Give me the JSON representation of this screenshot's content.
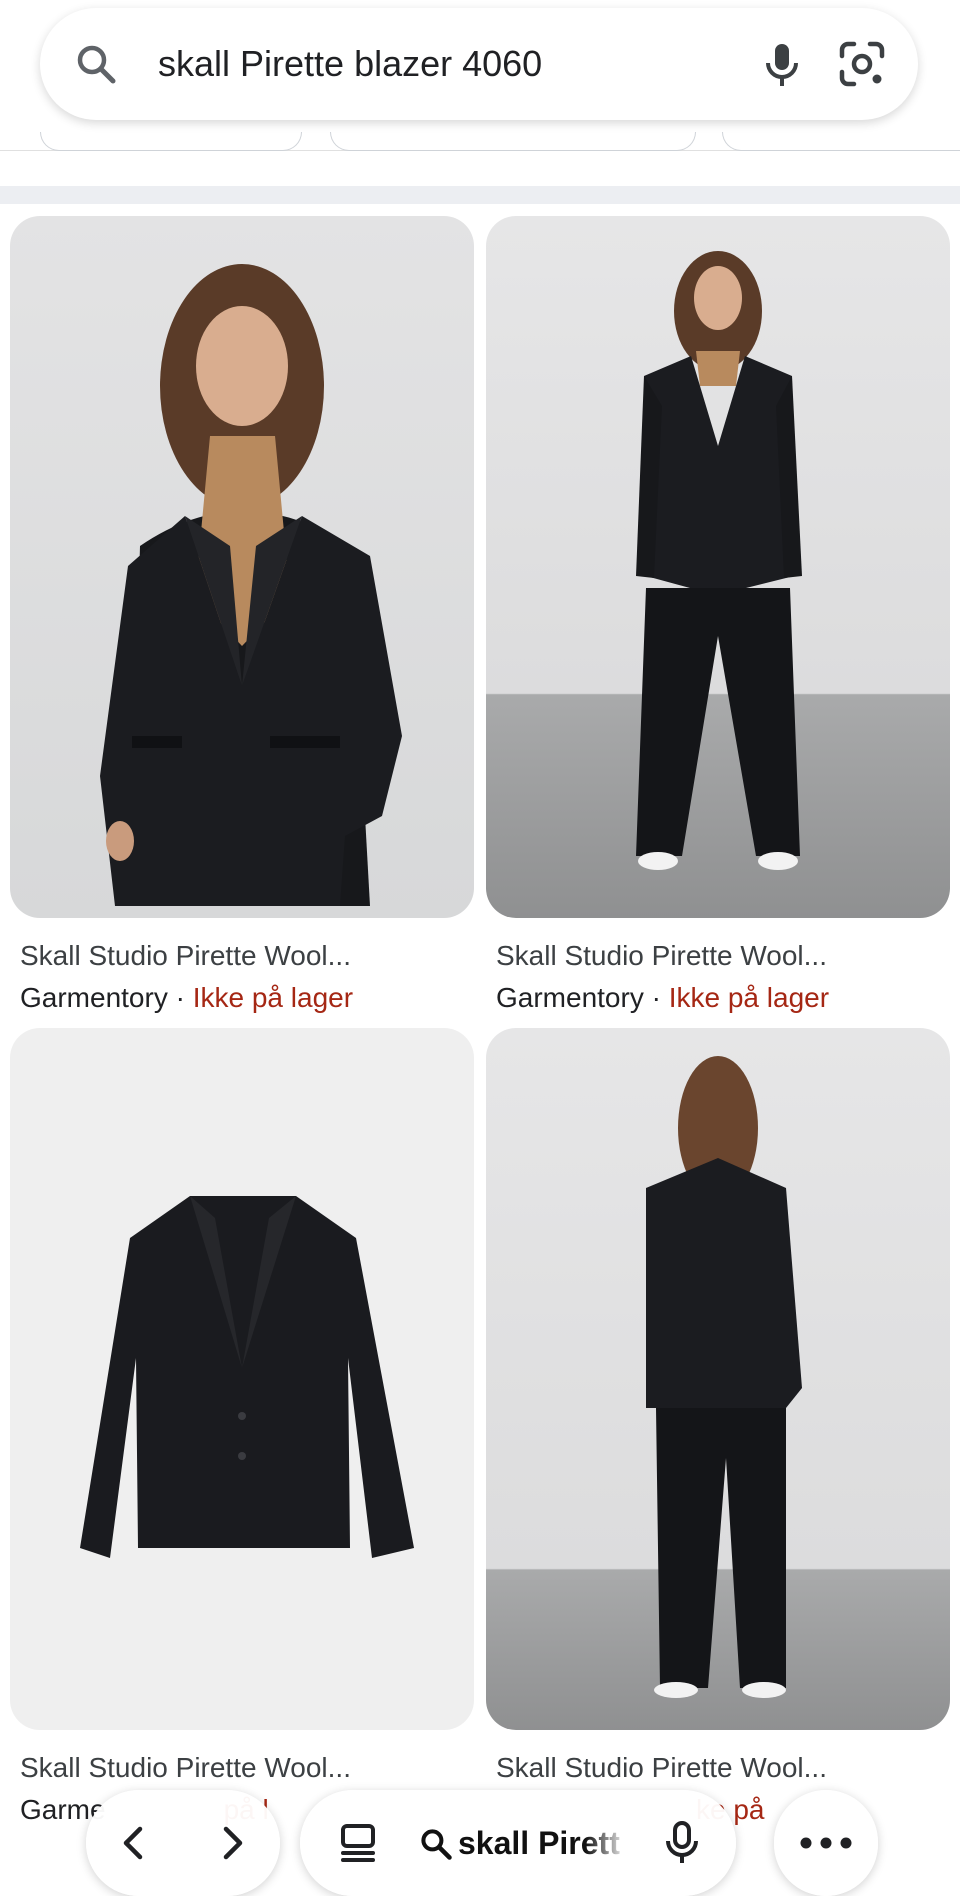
{
  "search": {
    "query": "skall Pirette blazer 4060",
    "icons": [
      "search-icon",
      "microphone-icon",
      "lens-camera-icon"
    ]
  },
  "results": [
    {
      "title": "Skall Studio Pirette Wool...",
      "store": "Garmentory",
      "separator": " · ",
      "stock": "Ikke på lager",
      "image": "woman-in-black-wool-blazer-close-up"
    },
    {
      "title": "Skall Studio Pirette Wool...",
      "store": "Garmentory",
      "separator": " · ",
      "stock": "Ikke på lager",
      "image": "woman-in-black-suit-full-length-front"
    },
    {
      "title": "Skall Studio Pirette Wool...",
      "store": "Garme",
      "separator": "",
      "stock": "på l",
      "image": "black-blazer-product-flat"
    },
    {
      "title": "Skall Studio Pirette Wool...",
      "store": "",
      "separator": "",
      "stock": "ke på",
      "image": "woman-in-black-suit-full-length-back"
    }
  ],
  "bottom_bar": {
    "query_preview": "skall Pirett",
    "icons": [
      "back-arrow-icon",
      "forward-arrow-icon",
      "tabs-icon",
      "search-icon",
      "microphone-icon",
      "more-options-icon"
    ]
  },
  "colors": {
    "stock_status": "#a52714",
    "divider": "#eceef2",
    "text": "#202124"
  }
}
